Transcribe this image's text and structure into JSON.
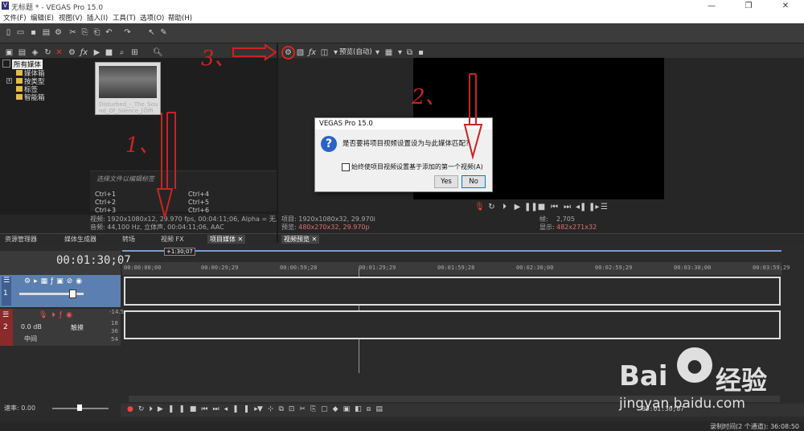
{
  "window": {
    "title": "无标题 * - VEGAS Pro 15.0",
    "minimize": "—",
    "maximize": "❐",
    "close": "✕"
  },
  "menu": [
    "文件(F)",
    "编辑(E)",
    "视图(V)",
    "插入(I)",
    "工具(T)",
    "选项(O)",
    "帮助(H)"
  ],
  "media_tree": {
    "items": [
      "所有媒体",
      "媒体箱",
      "按类型",
      "标签",
      "智能箱"
    ]
  },
  "thumbnail": {
    "caption": "Disturbed_-_The_Sou nd_Of_Silence_[Offi"
  },
  "tags": {
    "placeholder": "选择文件以编辑标签",
    "shortcuts": [
      "Ctrl+1",
      "Ctrl+2",
      "Ctrl+3",
      "Ctrl+4",
      "Ctrl+5",
      "Ctrl+6"
    ]
  },
  "media_props": {
    "line1": "视频: 1920x1080x12, 29.970 fps, 00:04:11;06, Alpha = 无, 场顺",
    "line2": "音频: 44,100 Hz, 立体声, 00:04:11;06, AAC"
  },
  "left_tabs": [
    "资源管理器",
    "媒体生成器",
    "转场",
    "视频 FX",
    "项目媒体"
  ],
  "preview": {
    "quality": "预览(自动)",
    "info_project": "项目: 1920x1080x32, 29.970i",
    "info_preview_label": "预览: ",
    "info_preview": "480x270x32, 29.970p",
    "frame_label": "帧:",
    "frame": "2,705",
    "display_label": "显示:",
    "display": "482x271x32",
    "tab": "视频预览"
  },
  "dialog": {
    "title": "VEGAS Pro 15.0",
    "icon": "?",
    "message": "是否要将项目视频设置设为与此媒体匹配?",
    "checkbox_label": "始终使项目视频设置基于添加的第一个视频(A)",
    "yes": "Yes",
    "no": "No"
  },
  "timeline": {
    "timecode": "00:01:30;07",
    "marker": "+1:30;07",
    "ruler": [
      "00:00:00;00",
      "00:00:29;29",
      "00:00:59;28",
      "00:01:29;29",
      "00:01:59;28",
      "00:02:30;00",
      "00:02:59;29",
      "00:03:30;00",
      "00:03:59;29"
    ],
    "video_track_num": "1",
    "audio_track_num": "2",
    "audio_db": "0.0 dB",
    "audio_pan": "中间",
    "audio_mode": "触摸",
    "audio_levels": [
      "-14.5",
      "18",
      "36",
      "54"
    ],
    "rate_label": "速率: 0.00",
    "end_timecode": "00:01:30;07"
  },
  "status": {
    "text": "录制时间(2 个通道): 36:08:50"
  },
  "annotations": {
    "n1": "1、",
    "n2": "2、",
    "n3": "3、"
  },
  "watermark": {
    "brand": "Bai",
    "brand2": "经验",
    "url": "jingyan.baidu.com"
  },
  "colors": {
    "annotation_red": "#cc2222",
    "video_track": "#5b7fb0",
    "dialog_icon": "#2a62c8"
  }
}
